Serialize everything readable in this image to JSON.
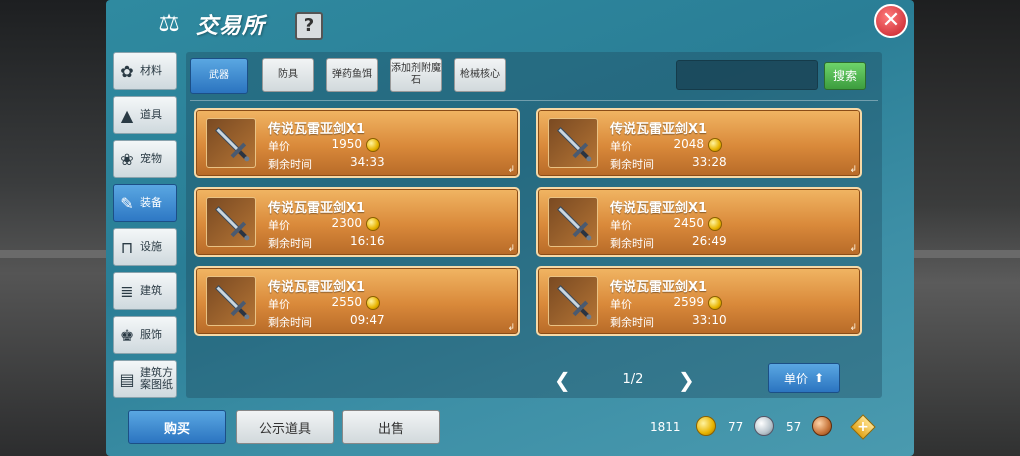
{
  "window": {
    "title": "交易所",
    "help_label": "?",
    "close_label": "✕"
  },
  "sidebar": {
    "items": [
      {
        "label": "材料",
        "icon": "materials-icon",
        "glyph": "✿"
      },
      {
        "label": "道具",
        "icon": "item-icon",
        "glyph": "▲"
      },
      {
        "label": "宠物",
        "icon": "pet-paw-icon",
        "glyph": "❀"
      },
      {
        "label": "装备",
        "icon": "equipment-icon",
        "glyph": "✎"
      },
      {
        "label": "设施",
        "icon": "facility-icon",
        "glyph": "⊓"
      },
      {
        "label": "建筑",
        "icon": "building-icon",
        "glyph": "≣"
      },
      {
        "label": "服饰",
        "icon": "clothing-icon",
        "glyph": "♚"
      },
      {
        "label": "建筑方案图纸",
        "icon": "blueprint-icon",
        "glyph": "▤"
      }
    ],
    "active_index": 3
  },
  "tabs": [
    {
      "label": "武器"
    },
    {
      "label": "防具"
    },
    {
      "label": "弹药鱼饵"
    },
    {
      "label": "添加剂附魔石"
    },
    {
      "label": "枪械核心"
    }
  ],
  "active_tab": 0,
  "search": {
    "placeholder": "",
    "button_label": "搜索"
  },
  "listings": [
    {
      "name": "传说瓦雷亚剑X1",
      "price_label": "单价",
      "price": "1950",
      "time_label": "剩余时间",
      "time": "34:33"
    },
    {
      "name": "传说瓦雷亚剑X1",
      "price_label": "单价",
      "price": "2048",
      "time_label": "剩余时间",
      "time": "33:28"
    },
    {
      "name": "传说瓦雷亚剑X1",
      "price_label": "单价",
      "price": "2300",
      "time_label": "剩余时间",
      "time": "16:16"
    },
    {
      "name": "传说瓦雷亚剑X1",
      "price_label": "单价",
      "price": "2450",
      "time_label": "剩余时间",
      "time": "26:49"
    },
    {
      "name": "传说瓦雷亚剑X1",
      "price_label": "单价",
      "price": "2550",
      "time_label": "剩余时间",
      "time": "09:47"
    },
    {
      "name": "传说瓦雷亚剑X1",
      "price_label": "单价",
      "price": "2599",
      "time_label": "剩余时间",
      "time": "33:10"
    }
  ],
  "pagination": {
    "indicator": "1/2"
  },
  "sort": {
    "label": "单价"
  },
  "bottom_buttons": {
    "buy": "购买",
    "show": "公示道具",
    "sell": "出售"
  },
  "currency": {
    "gold": "1811",
    "silver": "77",
    "copper": "57"
  }
}
